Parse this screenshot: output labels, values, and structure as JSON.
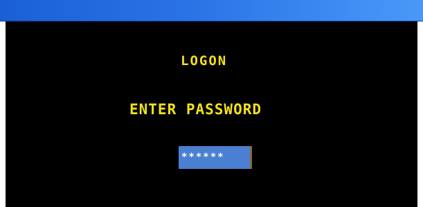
{
  "screen": {
    "title": "LOGON",
    "prompt": "ENTER PASSWORD",
    "password_value": "******"
  },
  "colors": {
    "titlebar": "#2a73e6",
    "screen_background": "#000000",
    "terminal_text": "#f4e11a",
    "field_background": "#4a7fd1"
  }
}
